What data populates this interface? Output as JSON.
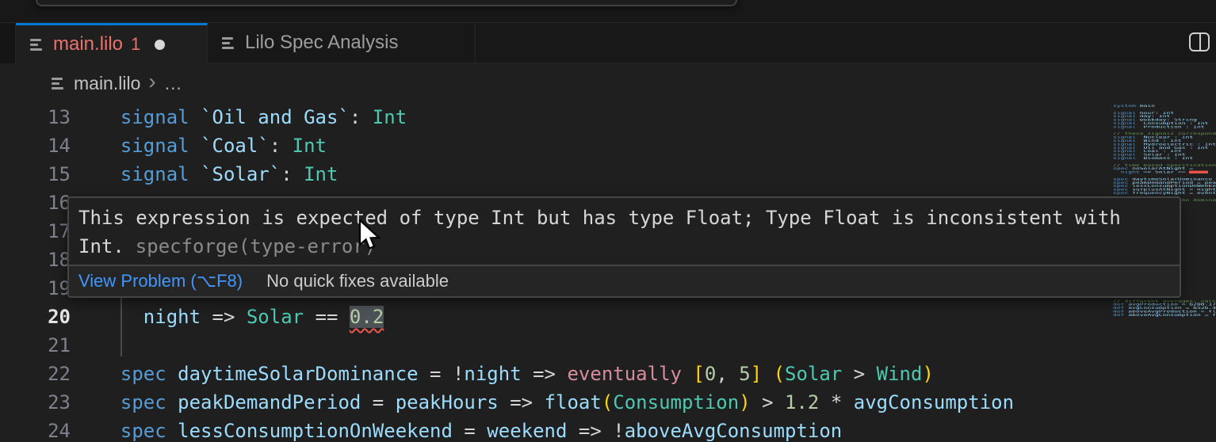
{
  "colors": {
    "accent_blue": "#0078d4",
    "error_red": "#f14c4c",
    "tab_error_label": "#e8736b",
    "link_blue": "#4097ff",
    "keyword": "#569cd6",
    "identifier": "#9cdcfe",
    "type": "#4ec9b0",
    "number": "#b5cea8",
    "control": "#d68c9d",
    "bracket": "#ffd602",
    "comment": "#6a9955",
    "editor_bg": "#1f1f1f",
    "shell_bg": "#181818"
  },
  "tabs": [
    {
      "label": "main.lilo",
      "badge": "1",
      "modified": true,
      "active": true
    },
    {
      "label": "Lilo Spec Analysis",
      "active": false
    }
  ],
  "breadcrumb": {
    "file": "main.lilo",
    "separator": "›",
    "more": "…"
  },
  "editor": {
    "lines": [
      {
        "num": "13",
        "tokens": [
          [
            "kw",
            "  signal "
          ],
          [
            "id",
            "`Oil and Gas`"
          ],
          [
            "op",
            ": "
          ],
          [
            "ty",
            "Int"
          ]
        ]
      },
      {
        "num": "14",
        "tokens": [
          [
            "kw",
            "  signal "
          ],
          [
            "id",
            "`Coal`"
          ],
          [
            "op",
            ": "
          ],
          [
            "ty",
            "Int"
          ]
        ]
      },
      {
        "num": "15",
        "tokens": [
          [
            "kw",
            "  signal "
          ],
          [
            "id",
            "`Solar`"
          ],
          [
            "op",
            ": "
          ],
          [
            "ty",
            "Int"
          ]
        ]
      },
      {
        "num": "16",
        "tokens": []
      },
      {
        "num": "17",
        "tokens": []
      },
      {
        "num": "18",
        "tokens": []
      },
      {
        "num": "19",
        "tokens": []
      },
      {
        "num": "20",
        "active": true,
        "tokens": [
          [
            "id",
            "    night "
          ],
          [
            "op",
            "=> "
          ],
          [
            "ty",
            "Solar "
          ],
          [
            "op",
            "== "
          ],
          [
            "er",
            "0.2"
          ]
        ]
      },
      {
        "num": "21",
        "tokens": []
      },
      {
        "num": "22",
        "tokens": [
          [
            "kw",
            "  spec "
          ],
          [
            "id",
            "daytimeSolarDominance "
          ],
          [
            "op",
            "= !"
          ],
          [
            "id",
            "night "
          ],
          [
            "op",
            "=> "
          ],
          [
            "ct",
            "eventually "
          ],
          [
            "br",
            "["
          ],
          [
            "nu",
            "0"
          ],
          [
            "op",
            ", "
          ],
          [
            "nu",
            "5"
          ],
          [
            "br",
            "]"
          ],
          [
            "op",
            " "
          ],
          [
            "br",
            "("
          ],
          [
            "ty",
            "Solar"
          ],
          [
            "op",
            " > "
          ],
          [
            "ty",
            "Wind"
          ],
          [
            "br",
            ")"
          ]
        ]
      },
      {
        "num": "23",
        "tokens": [
          [
            "kw",
            "  spec "
          ],
          [
            "id",
            "peakDemandPeriod "
          ],
          [
            "op",
            "= "
          ],
          [
            "id",
            "peakHours "
          ],
          [
            "op",
            "=> "
          ],
          [
            "id",
            "float"
          ],
          [
            "br",
            "("
          ],
          [
            "ty",
            "Consumption"
          ],
          [
            "br",
            ")"
          ],
          [
            "op",
            " > "
          ],
          [
            "nu",
            "1.2"
          ],
          [
            "op",
            " * "
          ],
          [
            "id",
            "avgConsumption"
          ]
        ]
      },
      {
        "num": "24",
        "tokens": [
          [
            "kw",
            "  spec "
          ],
          [
            "id",
            "lessConsumptionOnWeekend "
          ],
          [
            "op",
            "= "
          ],
          [
            "id",
            "weekend "
          ],
          [
            "op",
            "=> !"
          ],
          [
            "id",
            "aboveAvgConsumption"
          ]
        ]
      }
    ]
  },
  "hover": {
    "message_line1": "This expression is expected of type Int but has type Float; Type Float is inconsistent with",
    "message_strong": "Int.",
    "message_muted": "specforge(type-error)",
    "action_label": "View Problem (⌥F8)",
    "fixes_label": "No quick fixes available"
  },
  "minimap": {
    "lines": [
      [
        "c",
        "system main"
      ],
      [
        "b",
        ""
      ],
      [
        "c",
        "signal hour: Int"
      ],
      [
        "c",
        "signal day: Int"
      ],
      [
        "c",
        "signal weekday: String"
      ],
      [
        "c",
        "signal `Consumption`: Int"
      ],
      [
        "c",
        "signal `Production`: Int"
      ],
      [
        "b",
        ""
      ],
      [
        "m",
        "// these signals correspond to production (in MW)"
      ],
      [
        "c",
        "signal `Nuclear`: Int"
      ],
      [
        "c",
        "signal `Wind`: Int"
      ],
      [
        "c",
        "signal `Hydroelectric`: Int"
      ],
      [
        "c",
        "signal `Oil and Gas`: Int"
      ],
      [
        "c",
        "signal `Coal`: Int"
      ],
      [
        "c",
        "signal `Solar`: Int"
      ],
      [
        "c",
        "signal `Biomass`: Int"
      ],
      [
        "b",
        ""
      ],
      [
        "m",
        "// time based specifications"
      ],
      [
        "c",
        "spec noSolarAtNight ="
      ],
      [
        "e",
        "  night => Solar == "
      ],
      [
        "b",
        ""
      ],
      [
        "c",
        "spec daytimeSolarDominance = !night => eventually [0, 5] (Solar"
      ],
      [
        "c",
        "spec peakDemandPeriod = peakHours => float(Consumption) > 1.2 *"
      ],
      [
        "c",
        "spec lessConsumptionOnWeekend = weekend => !aboveAvgConsumption"
      ],
      [
        "c",
        "spec surplusAtNight = night => haveSurplus"
      ],
      [
        "c",
        "spec frequencyNight = eventually [0, 12] night"
      ],
      [
        "b",
        ""
      ],
      [
        "m",
        "// deviation between dominance of renewable energy sources"
      ],
      [
        "g",
        "28"
      ],
      [
        "m",
        "// different averages, calculated externally"
      ],
      [
        "c",
        "def avgProduction = 6208.179"
      ],
      [
        "c",
        "def avgConsumption = 6526.461"
      ],
      [
        "c",
        "def aboveAvgProduction = float(Production) > avgProduction"
      ],
      [
        "c",
        "def aboveAvgConsumption = float(Consumption) > avgConsumption"
      ]
    ]
  }
}
